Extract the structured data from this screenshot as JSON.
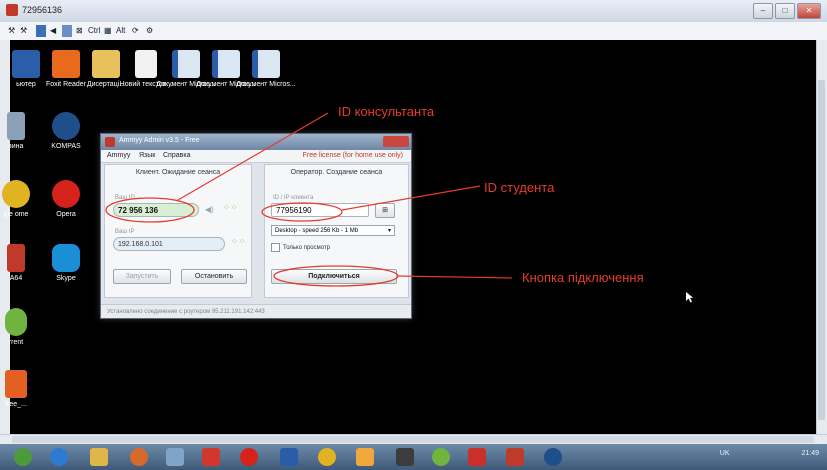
{
  "window": {
    "title": "72956136"
  },
  "toolbar": {
    "items": [
      "Ctrl",
      "Alt"
    ]
  },
  "desktop": {
    "icons_row1": [
      "ьютер",
      "Foxit Reader",
      "Дисертаці...",
      "Новий текстов...",
      "Документ Micros...",
      "Документ Micros...",
      "Документ Micros..."
    ],
    "icons_left": [
      "зина",
      "KOMPAS",
      "gle ome",
      "Opera",
      "A64",
      "Skype",
      "rrent",
      "free_..."
    ]
  },
  "ammyy": {
    "title": "Ammyy Admin v3.5 - Free",
    "menu": [
      "Ammyy",
      "Язык",
      "Справка"
    ],
    "free_note": "Free license (for home use only)",
    "client": {
      "header": "Клиент. Ожидание сеанса",
      "id_caption": "Ваш ID",
      "id_value": "72 956 136",
      "ip_caption": "Ваш IP",
      "ip_value": "192.168.0.101",
      "start_label": "Запустить",
      "stop_label": "Остановить"
    },
    "operator": {
      "header": "Оператор. Создание сеанса",
      "client_caption": "ID / IP клиента",
      "client_value": "77956190",
      "speed_value": "Desktop - speed 256 Kb - 1 Mb",
      "view_only_label": "Только просмотр",
      "connect_label": "Подключиться"
    },
    "status": "Установлено соединение с роутером 95.211.191.142:443"
  },
  "annotations": {
    "consultant_id": "ID консультанта",
    "student_id": "ID студента",
    "connect_button": "Кнопка підключення"
  },
  "tray": {
    "text": "UK",
    "clock": "21:49"
  }
}
